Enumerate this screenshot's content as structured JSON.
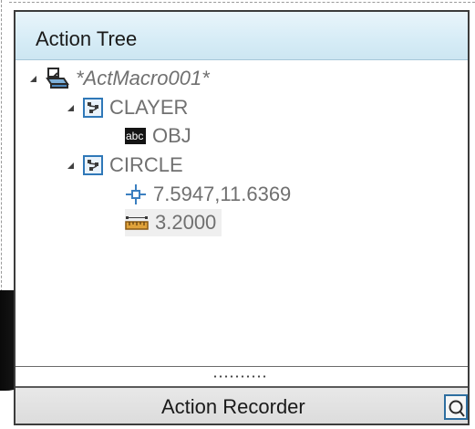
{
  "palette": {
    "title": "Action Tree",
    "footer_title": "Action Recorder"
  },
  "tree": {
    "root": {
      "label": "*ActMacro001*",
      "icon": "macro-icon"
    },
    "groups": [
      {
        "label": "CLAYER",
        "icon": "command-node-icon",
        "children": [
          {
            "label": "OBJ",
            "icon": "text-value-icon"
          }
        ]
      },
      {
        "label": "CIRCLE",
        "icon": "command-node-icon",
        "children": [
          {
            "label": "7.5947,11.6369",
            "icon": "point-coordinate-icon"
          },
          {
            "label": "3.2000",
            "icon": "distance-value-icon"
          }
        ]
      }
    ]
  },
  "icons": {
    "text_value_glyph": "abc"
  },
  "colors": {
    "header_bg": "#d6ecf6",
    "node_icon_border": "#2f78b8",
    "tree_text": "#707070"
  }
}
